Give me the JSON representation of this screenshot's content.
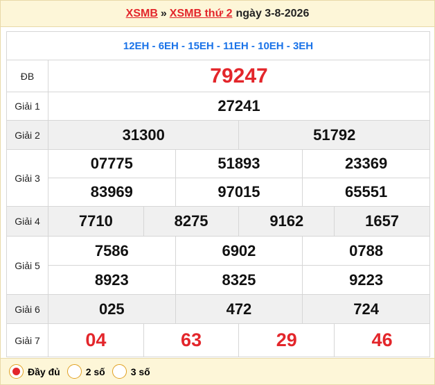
{
  "header": {
    "link1": "XSMB",
    "separator": "»",
    "link2": "XSMB thứ 2",
    "date": "ngày 3-8-2026"
  },
  "codes": "12EH - 6EH - 15EH - 11EH - 10EH - 3EH",
  "prizes": {
    "db": {
      "label": "ĐB",
      "numbers": [
        "79247"
      ]
    },
    "g1": {
      "label": "Giải 1",
      "numbers": [
        "27241"
      ]
    },
    "g2": {
      "label": "Giải 2",
      "numbers": [
        "31300",
        "51792"
      ]
    },
    "g3": {
      "label": "Giải 3",
      "numbers": [
        "07775",
        "51893",
        "23369",
        "83969",
        "97015",
        "65551"
      ]
    },
    "g4": {
      "label": "Giải 4",
      "numbers": [
        "7710",
        "8275",
        "9162",
        "1657"
      ]
    },
    "g5": {
      "label": "Giải 5",
      "numbers": [
        "7586",
        "6902",
        "0788",
        "8923",
        "8325",
        "9223"
      ]
    },
    "g6": {
      "label": "Giải 6",
      "numbers": [
        "025",
        "472",
        "724"
      ]
    },
    "g7": {
      "label": "Giải 7",
      "numbers": [
        "04",
        "63",
        "29",
        "46"
      ]
    }
  },
  "footer": {
    "options": [
      {
        "label": "Đầy đủ",
        "selected": true
      },
      {
        "label": "2 số",
        "selected": false
      },
      {
        "label": "3 số",
        "selected": false
      }
    ]
  },
  "colors": {
    "accent_red": "#e3262b",
    "code_blue": "#1a73e8",
    "header_bg": "#fdf6d8"
  }
}
